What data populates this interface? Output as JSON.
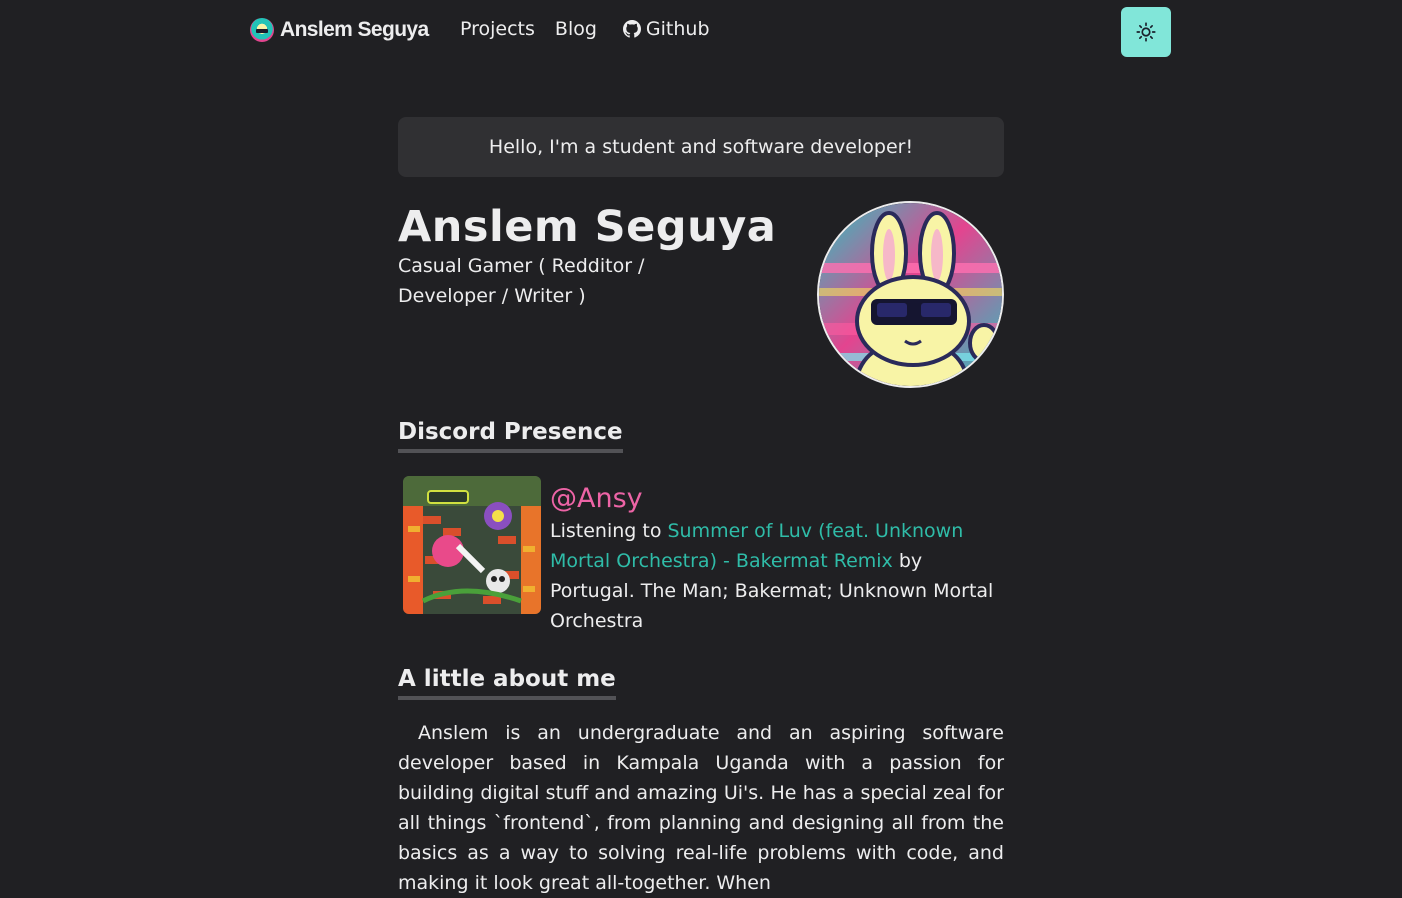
{
  "navbar": {
    "brand_name": "Anslem Seguya",
    "links": [
      {
        "label": "Projects"
      },
      {
        "label": "Blog"
      },
      {
        "label": "Github",
        "icon": "github-icon"
      }
    ],
    "theme_toggle_icon": "sun-icon",
    "theme_toggle_color": "#81e6d9"
  },
  "hero": {
    "greeting": "Hello, I'm a student and software developer!"
  },
  "profile": {
    "name": "Anslem Seguya",
    "subtitle": "Casual Gamer ( Redditor / Developer / Writer )"
  },
  "discord": {
    "heading": "Discord Presence",
    "username": "@Ansy",
    "listening_prefix": "Listening to",
    "song": "Summer of Luv (feat. Unknown Mortal Orchestra) - Bakermat Remix",
    "by_prefix": "by",
    "artists": "Portugal. The Man; Bakermat; Unknown Mortal Orchestra",
    "username_color": "#ed64a6",
    "song_color": "#2fbca8"
  },
  "about": {
    "heading": "A little about me",
    "text": "Anslem is an undergraduate and an aspiring software developer based in Kampala Uganda with a passion for building digital stuff and amazing Ui's. He has a special zeal for all things `frontend`, from planning and designing all from the basics as a way to solving real-life problems with code, and making it look great all-together. When"
  },
  "colors": {
    "background": "#202023",
    "card": "#303033",
    "text": "#ededee"
  }
}
